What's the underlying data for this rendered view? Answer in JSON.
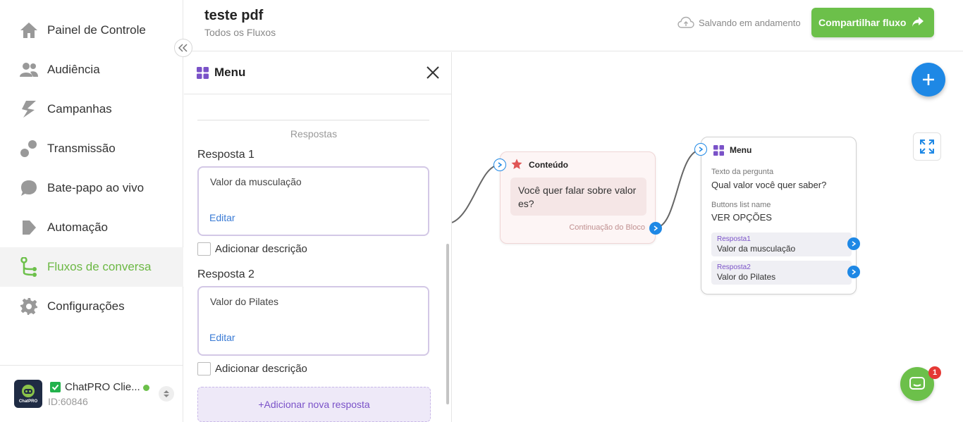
{
  "sidebar": {
    "items": [
      {
        "label": "Painel de Controle",
        "icon": "home-icon"
      },
      {
        "label": "Audiência",
        "icon": "users-icon"
      },
      {
        "label": "Campanhas",
        "icon": "campaign-icon"
      },
      {
        "label": "Transmissão",
        "icon": "broadcast-icon"
      },
      {
        "label": "Bate-papo ao vivo",
        "icon": "chat-icon"
      },
      {
        "label": "Automação",
        "icon": "automation-icon"
      },
      {
        "label": "Fluxos de conversa",
        "icon": "flow-icon",
        "active": true
      },
      {
        "label": "Configurações",
        "icon": "gear-icon"
      }
    ],
    "account": {
      "name": "ChatPRO Clie...",
      "id": "ID:60846",
      "logo_text": "ChatPRO"
    }
  },
  "header": {
    "title": "teste pdf",
    "subtitle": "Todos os Fluxos",
    "save_status": "Salvando em andamento",
    "share_label": "Compartilhar fluxo"
  },
  "panel": {
    "title": "Menu",
    "section_label": "Respostas",
    "responses": [
      {
        "label": "Resposta 1",
        "value": "Valor da musculação",
        "edit": "Editar",
        "desc": "Adicionar descrição"
      },
      {
        "label": "Resposta 2",
        "value": "Valor do Pilates",
        "edit": "Editar",
        "desc": "Adicionar descrição"
      }
    ],
    "add_response": "+Adicionar nova resposta"
  },
  "canvas": {
    "content_node": {
      "title": "Conteúdo",
      "message": "Você quer falar sobre valor es?",
      "continuation": "Continuação do Bloco"
    },
    "menu_node": {
      "title": "Menu",
      "question_key": "Texto da pergunta",
      "question_value": "Qual valor você quer saber?",
      "buttons_key": "Buttons list name",
      "buttons_value": "VER OPÇÕES",
      "options": [
        {
          "key": "Resposta1",
          "value": "Valor da musculação"
        },
        {
          "key": "Resposta2",
          "value": "Valor do Pilates"
        }
      ]
    },
    "chat_badge": "1"
  },
  "colors": {
    "accent_green": "#6cc04a",
    "accent_blue": "#1e88e5",
    "accent_purple": "#7a52c8"
  }
}
